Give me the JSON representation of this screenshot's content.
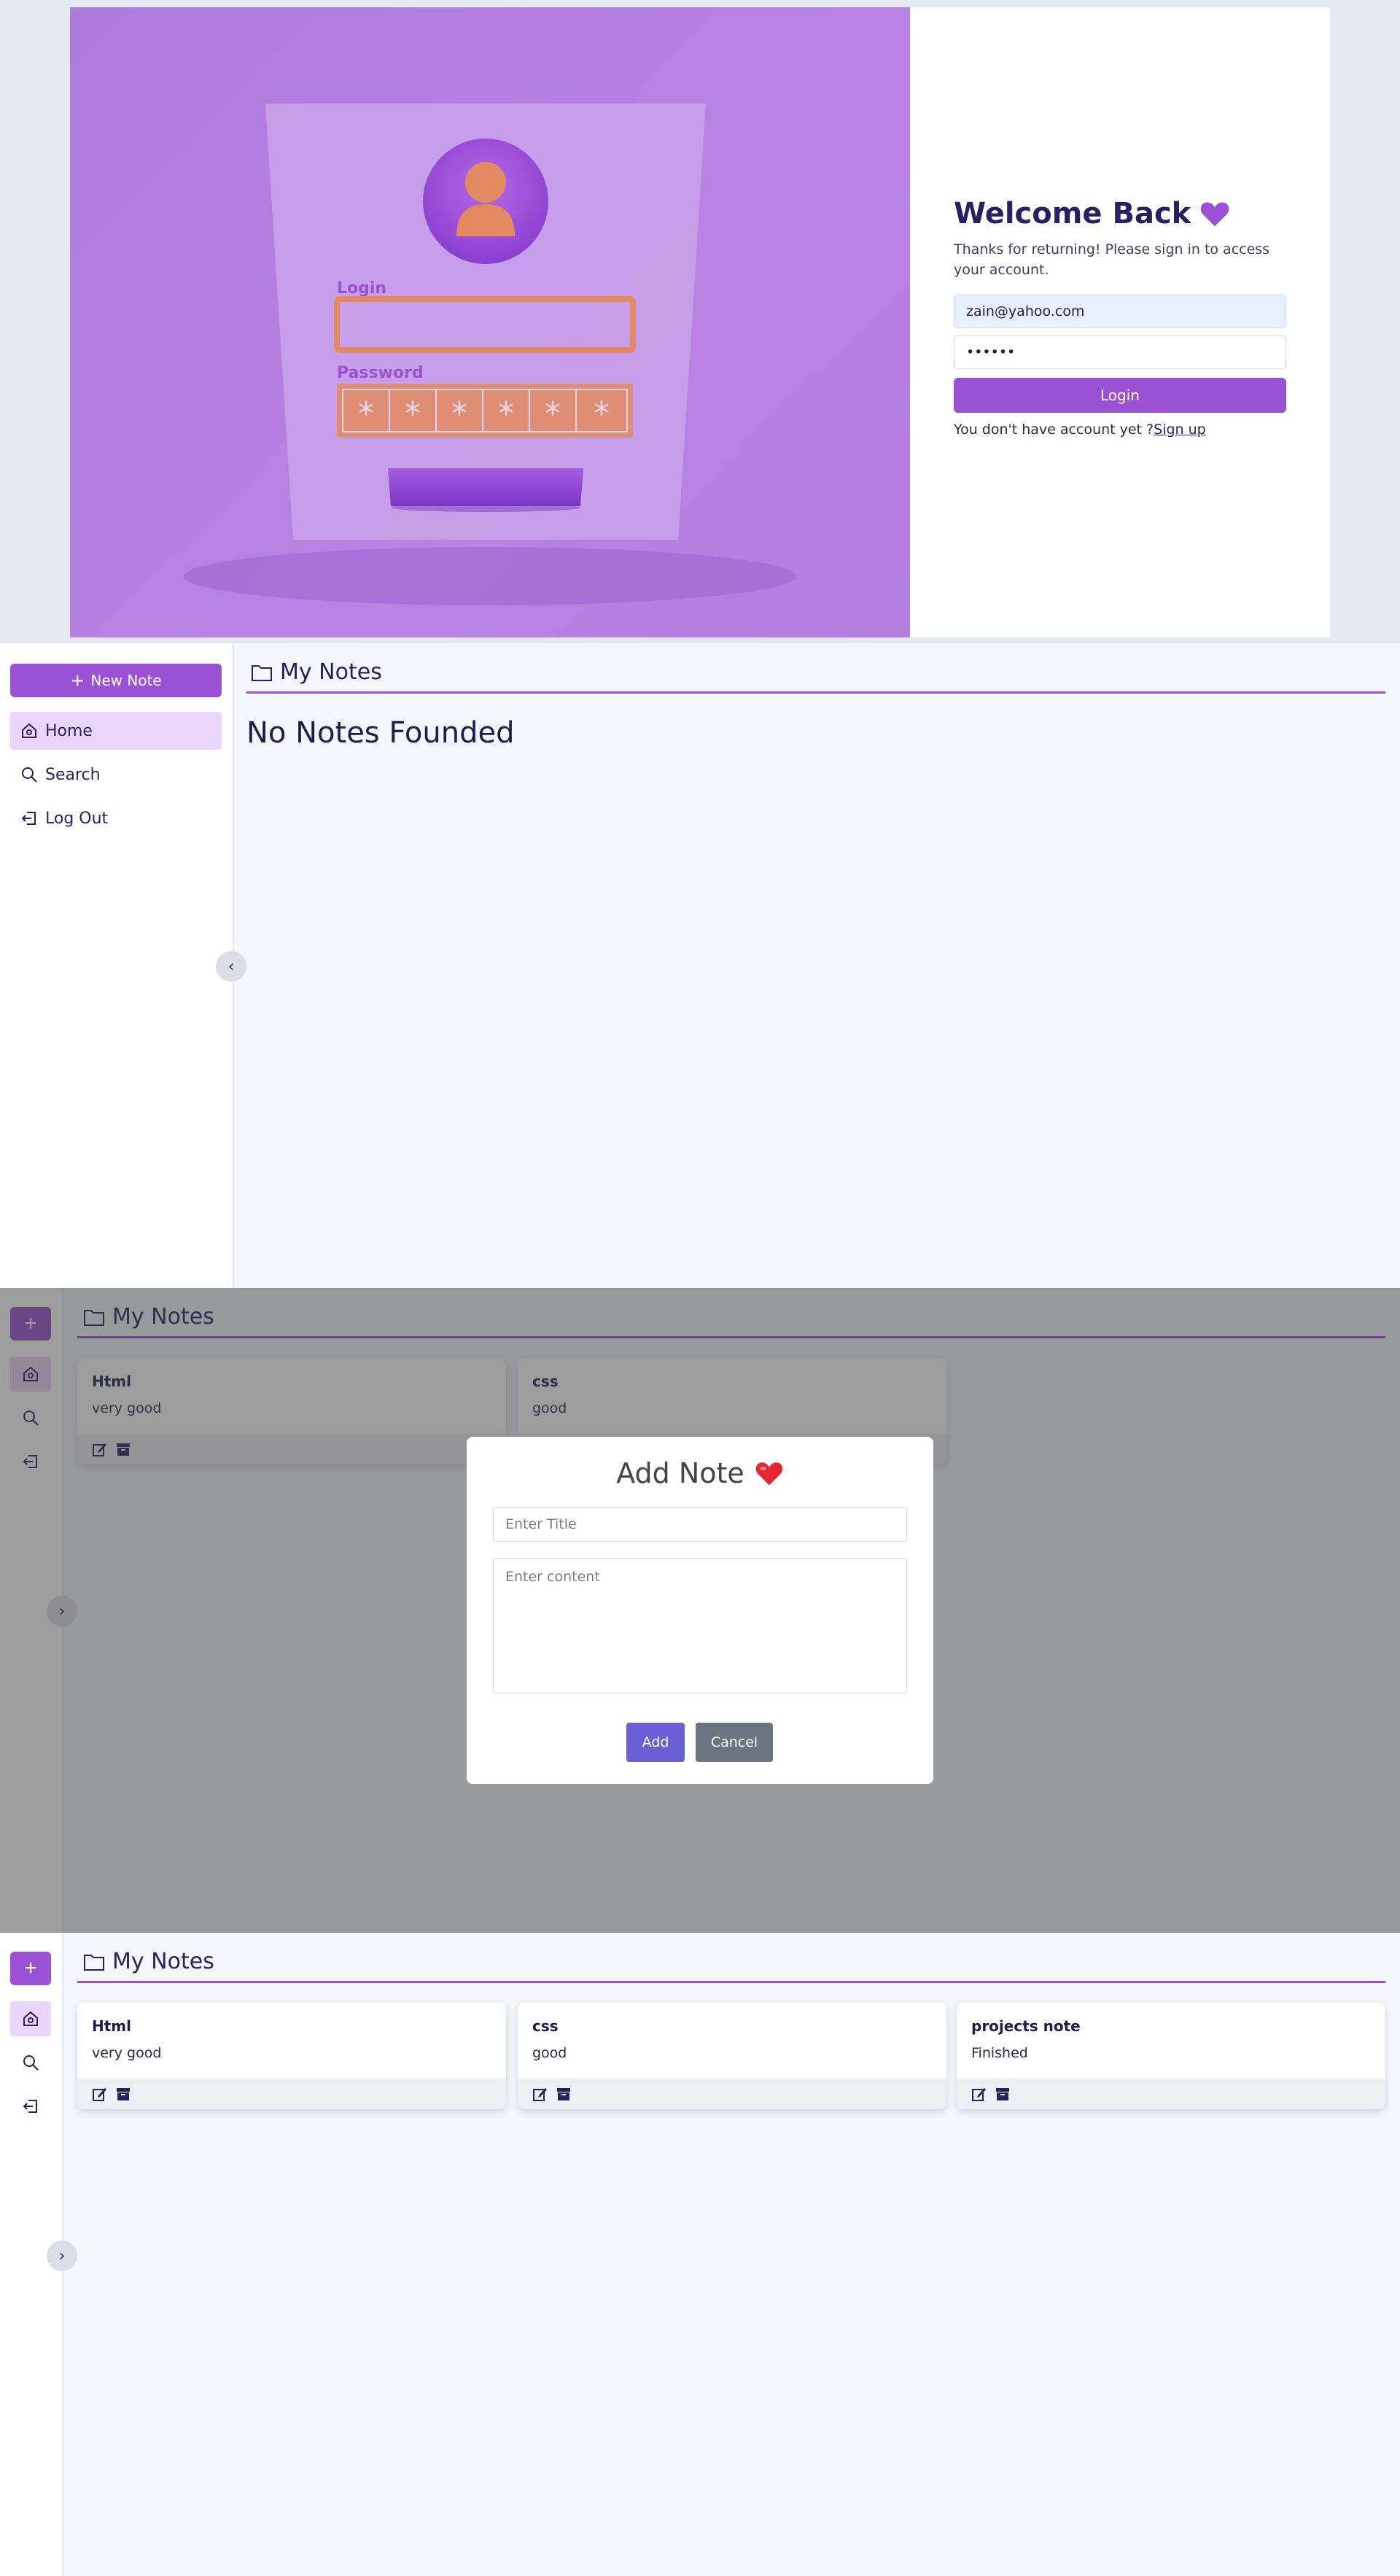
{
  "login": {
    "heading": "Welcome Back",
    "subtitle": "Thanks for returning! Please sign in to access your account.",
    "email_value": "zain@yahoo.com",
    "password_value": "••••••",
    "login_button": "Login",
    "signup_prompt": "You don't have account yet ?",
    "signup_link": "Sign up",
    "hero": {
      "login_label": "Login",
      "password_label": "Password",
      "mask_char": "*"
    },
    "colors": {
      "accent": "#9a51d3",
      "heading": "#2a1f63",
      "hero_bg": "#b27ddf"
    }
  },
  "app": {
    "new_note_label": "New Note",
    "page_title": "My Notes",
    "nav": [
      {
        "label": "Home",
        "icon": "home-icon"
      },
      {
        "label": "Search",
        "icon": "search-icon"
      },
      {
        "label": "Log Out",
        "icon": "logout-icon"
      }
    ],
    "empty_message": "No Notes Founded"
  },
  "modal": {
    "title": "Add Note",
    "title_placeholder": "Enter Title",
    "content_placeholder": "Enter content",
    "add_label": "Add",
    "cancel_label": "Cancel"
  },
  "notes": [
    {
      "title": "Html",
      "content": "very good"
    },
    {
      "title": "css",
      "content": "good"
    },
    {
      "title": "projects note",
      "content": "Finished"
    }
  ]
}
